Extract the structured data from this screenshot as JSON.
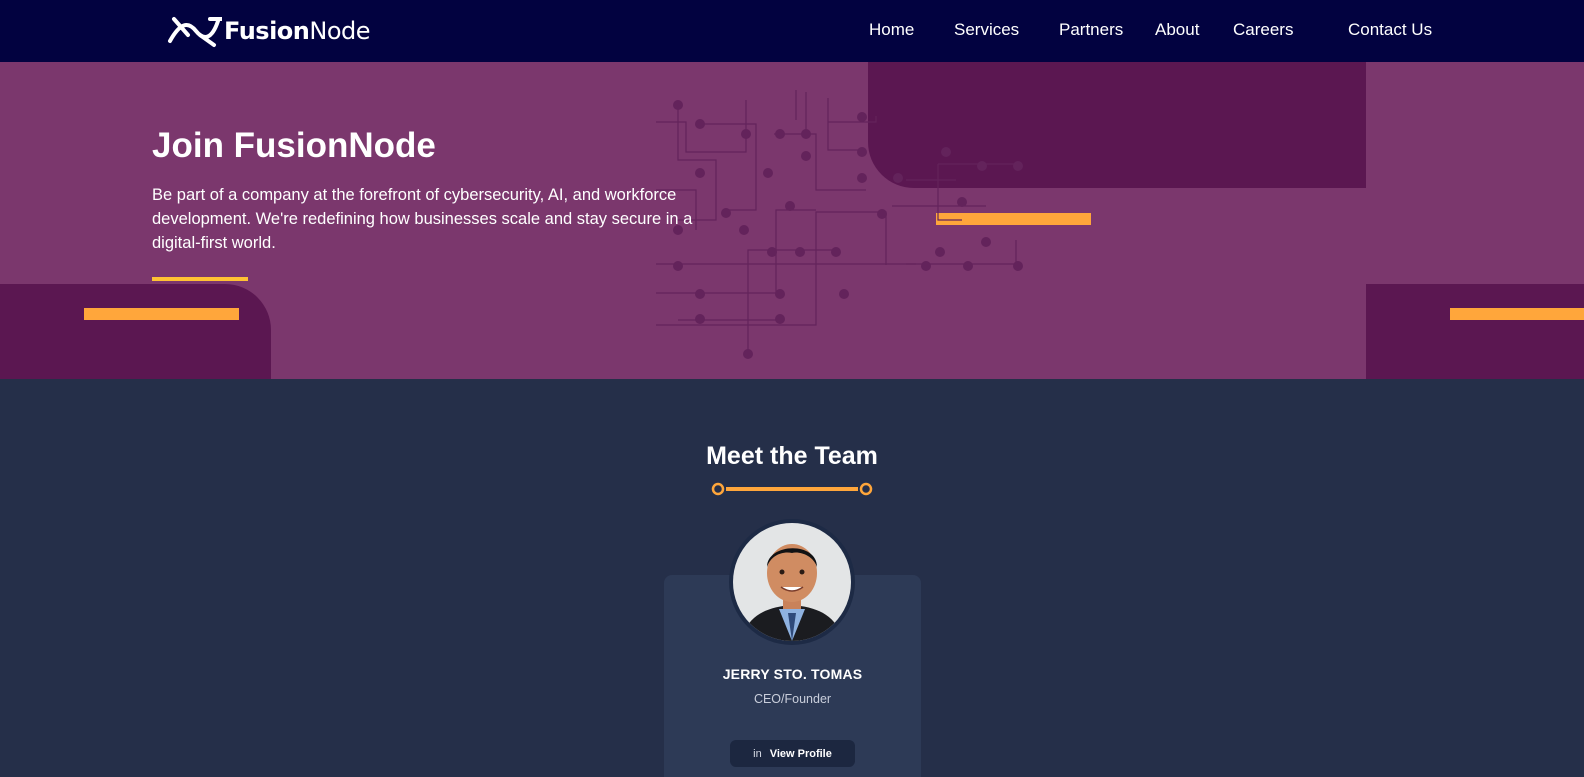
{
  "brand": {
    "name_bold": "Fusion",
    "name_light": "Node"
  },
  "nav": {
    "items": [
      "Home",
      "Services",
      "Partners",
      "About",
      "Careers",
      "Contact Us"
    ]
  },
  "hero": {
    "title": "Join FusionNode",
    "description": "Be part of a company at the forefront of cybersecurity, AI, and workforce development. We're redefining how businesses scale and stay secure in a digital-first world."
  },
  "team": {
    "title": "Meet the Team",
    "members": [
      {
        "name": "JERRY STO. TOMAS",
        "role": "CEO/Founder",
        "button_label": "View Profile",
        "button_icon": "linkedin-icon"
      }
    ]
  },
  "colors": {
    "nav_bg": "#020240",
    "hero_bg": "#7b376d",
    "hero_block": "#5b1751",
    "accent": "#ffa63b",
    "team_bg": "#252f49",
    "card_bg": "#2d3a56"
  }
}
